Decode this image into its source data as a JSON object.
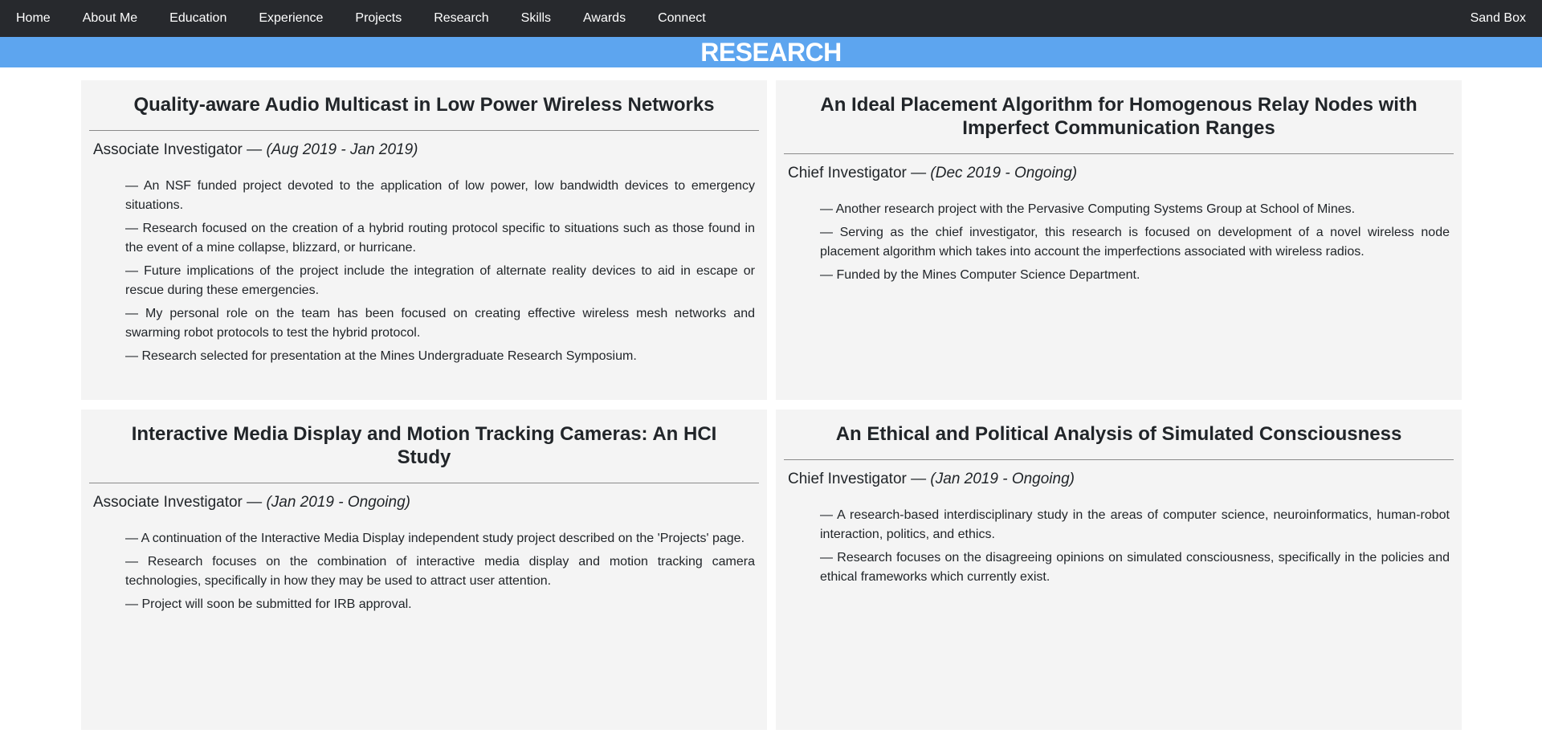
{
  "nav": {
    "items": [
      {
        "label": "Home",
        "name": "nav-home"
      },
      {
        "label": "About Me",
        "name": "nav-about-me"
      },
      {
        "label": "Education",
        "name": "nav-education"
      },
      {
        "label": "Experience",
        "name": "nav-experience"
      },
      {
        "label": "Projects",
        "name": "nav-projects"
      },
      {
        "label": "Research",
        "name": "nav-research"
      },
      {
        "label": "Skills",
        "name": "nav-skills"
      },
      {
        "label": "Awards",
        "name": "nav-awards"
      },
      {
        "label": "Connect",
        "name": "nav-connect"
      }
    ],
    "right_label": "Sand Box"
  },
  "banner": {
    "title": "RESEARCH"
  },
  "colors": {
    "navbar": "#27292d",
    "banner": "#5da5ef",
    "card": "#f4f4f4"
  },
  "cards": [
    {
      "title": "Quality-aware Audio Multicast in Low Power Wireless Networks",
      "role": "Associate Investigator — ",
      "dates": "(Aug 2019 - Jan 2019)",
      "bullets": [
        "— An NSF funded project devoted to the application of low power, low bandwidth devices to emergency situations.",
        "— Research focused on the creation of a hybrid routing protocol specific to situations such as those found in the event of a mine collapse, blizzard, or hurricane.",
        "— Future implications of the project include the integration of alternate reality devices to aid in escape or rescue during these emergencies.",
        "— My personal role on the team has been focused on creating effective wireless mesh networks and swarming robot protocols to test the hybrid protocol.",
        "— Research selected for presentation at the Mines Undergraduate Research Symposium."
      ]
    },
    {
      "title": "An Ideal Placement Algorithm for Homogenous Relay Nodes with Imperfect Communication Ranges",
      "role": "Chief Investigator — ",
      "dates": "(Dec 2019 - Ongoing)",
      "bullets": [
        "— Another research project with the Pervasive Computing Systems Group at School of Mines.",
        "— Serving as the chief investigator, this research is focused on development of a novel wireless node placement algorithm which takes into account the imperfections associated with wireless radios.",
        "— Funded by the Mines Computer Science Department."
      ]
    },
    {
      "title": "Interactive Media Display and Motion Tracking Cameras: An HCI Study",
      "role": "Associate Investigator — ",
      "dates": "(Jan 2019 - Ongoing)",
      "bullets": [
        "— A continuation of the Interactive Media Display independent study project described on the 'Projects' page.",
        "— Research focuses on the combination of interactive media display and motion tracking camera technologies, specifically in how they may be used to attract user attention.",
        "— Project will soon be submitted for IRB approval."
      ]
    },
    {
      "title": "An Ethical and Political Analysis of Simulated Consciousness",
      "role": "Chief Investigator — ",
      "dates": "(Jan 2019 - Ongoing)",
      "bullets": [
        "— A research-based interdisciplinary study in the areas of computer science, neuroinformatics, human-robot interaction, politics, and ethics.",
        "— Research focuses on the disagreeing opinions on simulated consciousness, specifically in the policies and ethical frameworks which currently exist."
      ]
    }
  ]
}
